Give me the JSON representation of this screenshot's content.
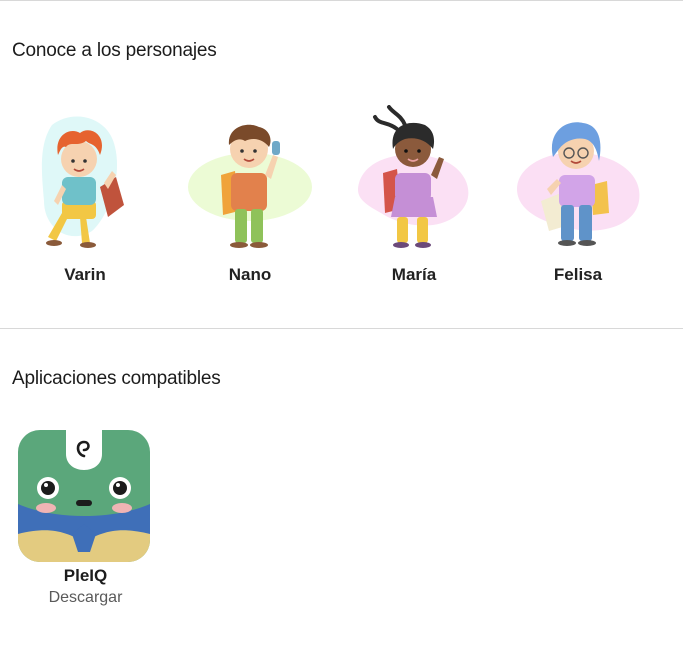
{
  "characters_section": {
    "title": "Conoce a los personajes",
    "characters": [
      {
        "name": "Varin",
        "blob_color": "#dff8f8",
        "hair_color": "#e6632f",
        "shirt_color": "#6fc1c9",
        "pants_color": "#f2c744",
        "backpack_color": "#c0533c",
        "icon": "boy-curly-red-hair-icon"
      },
      {
        "name": "Nano",
        "blob_color": "#ecfbd5",
        "hair_color": "#7a4a2a",
        "shirt_color": "#e2814c",
        "pants_color": "#8fc25a",
        "backpack_color": "#f0a33a",
        "icon": "boy-brown-hair-icon"
      },
      {
        "name": "María",
        "blob_color": "#fbe0f4",
        "hair_color": "#2b2b2b",
        "shirt_color": "#c58fd6",
        "pants_color": "#f2c744",
        "backpack_color": "#d4554a",
        "icon": "girl-braids-icon"
      },
      {
        "name": "Felisa",
        "blob_color": "#fbdff4",
        "hair_color": "#6d9fe0",
        "shirt_color": "#d2a4e8",
        "pants_color": "#5f93c9",
        "backpack_color": "#f3c24c",
        "icon": "girl-blue-hair-glasses-icon"
      }
    ]
  },
  "apps_section": {
    "title": "Aplicaciones compatibles",
    "apps": [
      {
        "name": "PleIQ",
        "action": "Descargar",
        "icon": "pleiq-app-icon",
        "colors": {
          "face": "#5ba77b",
          "collar": "#3f6fb8",
          "sand": "#e3cb80",
          "cheek": "#f0b4b4"
        }
      }
    ]
  }
}
